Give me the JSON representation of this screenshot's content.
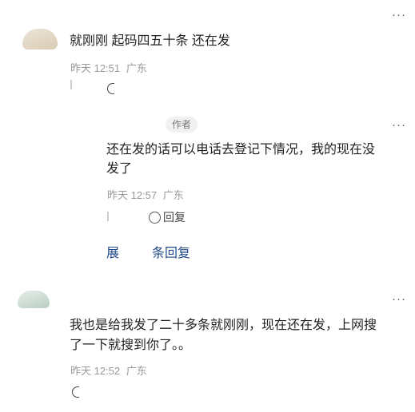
{
  "comments": [
    {
      "text": "就刚刚 起码四五十条 还在发",
      "time": "昨天 12:51",
      "location": "广东"
    },
    {
      "badge": "作者",
      "text_line1": "还在发的话可以电话去登记下情况，我的现在没",
      "text_line2": "发了",
      "time": "昨天 12:57",
      "location": "广东",
      "reply_label": "回复"
    },
    {
      "text_line1": "我也是给我发了二十多条就刚刚，现在还在发，上网搜",
      "text_line2": "了一下就搜到你了。。",
      "time": "昨天 12:52",
      "location": "广东"
    }
  ],
  "thread_actions": {
    "expand_label": "展",
    "reply_count_label": "条回复"
  },
  "icons": {
    "more": "⋮",
    "more_horizontal": "···"
  },
  "colors": {
    "link": "#1f4a8c",
    "meta": "#999999"
  }
}
